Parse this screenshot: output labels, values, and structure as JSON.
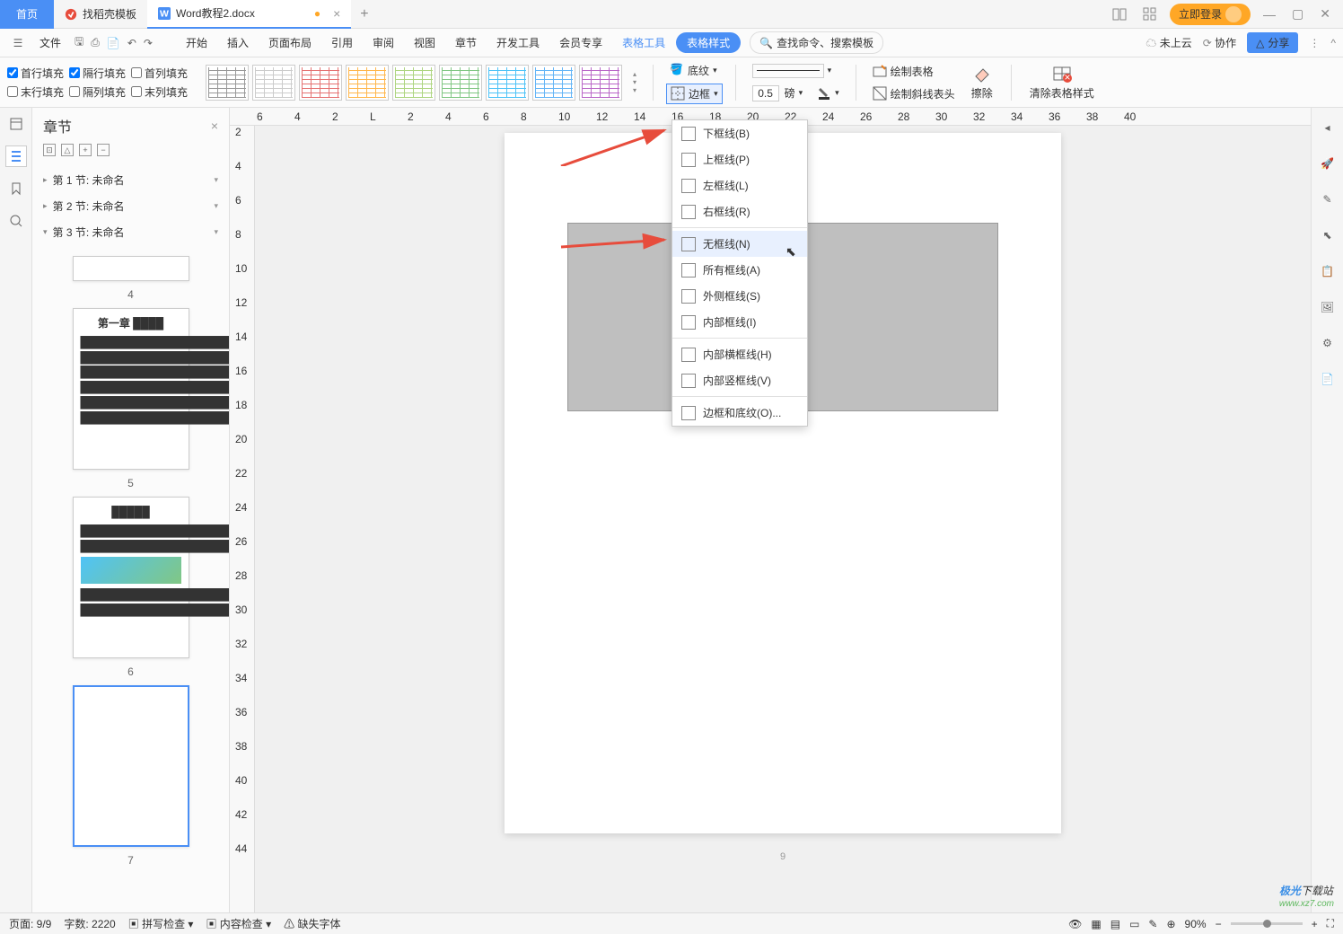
{
  "titlebar": {
    "home": "首页",
    "template_tab": "找稻壳模板",
    "doc_tab": "Word教程2.docx",
    "login": "立即登录"
  },
  "menubar": {
    "file": "文件",
    "tabs": [
      "开始",
      "插入",
      "页面布局",
      "引用",
      "审阅",
      "视图",
      "章节",
      "开发工具",
      "会员专享"
    ],
    "context1": "表格工具",
    "context2": "表格样式",
    "search_ph": "查找命令、搜索模板",
    "cloud": "未上云",
    "coop": "协作",
    "share": "分享"
  },
  "toolbar": {
    "fills": [
      [
        "首行填充",
        "隔行填充",
        "首列填充"
      ],
      [
        "末行填充",
        "隔列填充",
        "末列填充"
      ]
    ],
    "fill_checked": [
      true,
      true,
      false,
      false,
      false,
      false
    ],
    "shading": "底纹",
    "border": "边框",
    "width_val": "0.5",
    "width_unit": "磅",
    "draw_table": "绘制表格",
    "draw_diag": "绘制斜线表头",
    "erase": "擦除",
    "clear_style": "清除表格样式"
  },
  "sidebar": {
    "title": "章节",
    "items": [
      {
        "label": "第 1 节: 未命名",
        "active": false
      },
      {
        "label": "第 2 节: 未命名",
        "active": false
      },
      {
        "label": "第 3 节: 未命名",
        "active": true
      }
    ],
    "thumb_nums": [
      "4",
      "5",
      "6",
      "7"
    ]
  },
  "ruler_h": [
    "6",
    "4",
    "2",
    "L",
    "2",
    "4",
    "6",
    "8",
    "10",
    "12",
    "14",
    "16",
    "18",
    "20",
    "22",
    "24",
    "26",
    "28",
    "30",
    "32",
    "34",
    "36",
    "38",
    "40"
  ],
  "ruler_v": [
    "2",
    "4",
    "6",
    "8",
    "10",
    "12",
    "14",
    "16",
    "18",
    "20",
    "22",
    "24",
    "26",
    "28",
    "30",
    "32",
    "34",
    "36",
    "38",
    "40",
    "42",
    "44"
  ],
  "page_number": "9",
  "dropdown": {
    "items": [
      {
        "label": "下框线(B)"
      },
      {
        "label": "上框线(P)"
      },
      {
        "label": "左框线(L)"
      },
      {
        "label": "右框线(R)"
      },
      {
        "sep": true
      },
      {
        "label": "无框线(N)",
        "hover": true
      },
      {
        "label": "所有框线(A)"
      },
      {
        "label": "外侧框线(S)"
      },
      {
        "label": "内部框线(I)"
      },
      {
        "sep": true
      },
      {
        "label": "内部横框线(H)"
      },
      {
        "label": "内部竖框线(V)"
      },
      {
        "sep": true
      },
      {
        "label": "边框和底纹(O)..."
      }
    ]
  },
  "status": {
    "page": "页面: 9/9",
    "words": "字数: 2220",
    "spell": "拼写检查",
    "content": "内容检查",
    "font": "缺失字体",
    "zoom": "90%"
  },
  "watermark": {
    "a": "极光",
    "b": "下载站",
    "url": "www.xz7.com"
  },
  "style_colors": [
    "#999",
    "#ccc",
    "#e57373",
    "#ffb74d",
    "#aed581",
    "#81c784",
    "#4fc3f7",
    "#64b5f6",
    "#ba68c8",
    "#999",
    "#ccc",
    "#e57373",
    "#ffb74d",
    "#aed581",
    "#81c784",
    "#4fc3f7",
    "#64b5f6",
    "#ba68c8"
  ]
}
